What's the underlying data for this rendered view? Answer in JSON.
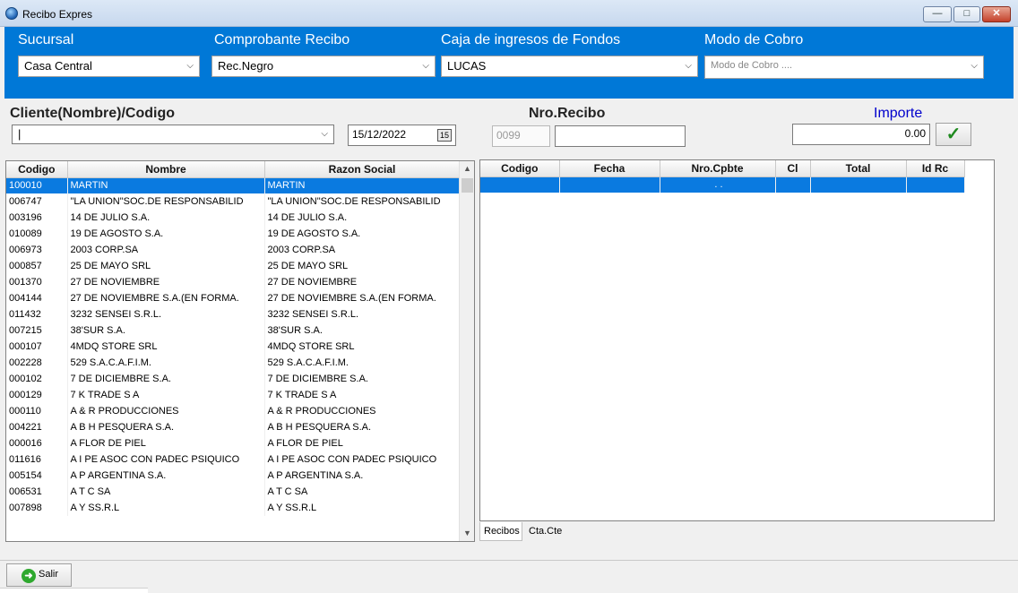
{
  "window": {
    "title": "Recibo Expres",
    "min": "—",
    "max": "□",
    "close": "✕"
  },
  "header": {
    "sucursal_label": "Sucursal",
    "sucursal_value": "Casa Central",
    "comprobante_label": "Comprobante Recibo",
    "comprobante_value": "Rec.Negro",
    "caja_label": "Caja de ingresos de Fondos",
    "caja_value": "LUCAS",
    "modo_label": "Modo de Cobro",
    "modo_placeholder": "Modo de Cobro ...."
  },
  "form": {
    "cliente_label": "Cliente(Nombre)/Codigo",
    "cliente_value": "|",
    "fecha": "15/12/2022",
    "nro_recibo_label": "Nro.Recibo",
    "nro_prefix": "0099",
    "nro_value": "",
    "importe_label": "Importe",
    "importe_value": "0.00"
  },
  "clients": {
    "columns": [
      "Codigo",
      "Nombre",
      "Razon Social"
    ],
    "rows": [
      [
        "100010",
        "MARTIN",
        "MARTIN"
      ],
      [
        "006747",
        "\"LA UNION\"SOC.DE RESPONSABILID",
        "\"LA UNION\"SOC.DE RESPONSABILID"
      ],
      [
        "003196",
        "14 DE JULIO S.A.",
        "14 DE JULIO S.A."
      ],
      [
        "010089",
        "19 DE AGOSTO S.A.",
        "19 DE AGOSTO S.A."
      ],
      [
        "006973",
        "2003 CORP.SA",
        "2003 CORP.SA"
      ],
      [
        "000857",
        "25 DE MAYO SRL",
        "25 DE MAYO SRL"
      ],
      [
        "001370",
        "27 DE NOVIEMBRE",
        "27 DE NOVIEMBRE"
      ],
      [
        "004144",
        "27 DE NOVIEMBRE S.A.(EN FORMA.",
        "27 DE NOVIEMBRE S.A.(EN FORMA."
      ],
      [
        "011432",
        "3232 SENSEI S.R.L.",
        "3232 SENSEI S.R.L."
      ],
      [
        "007215",
        "38'SUR S.A.",
        "38'SUR S.A."
      ],
      [
        "000107",
        "4MDQ STORE SRL",
        "4MDQ STORE SRL"
      ],
      [
        "002228",
        "529  S.A.C.A.F.I.M.",
        "529  S.A.C.A.F.I.M."
      ],
      [
        "000102",
        "7 DE DICIEMBRE S.A.",
        "7 DE DICIEMBRE S.A."
      ],
      [
        "000129",
        "7 K TRADE S A",
        "7 K TRADE S A"
      ],
      [
        "000110",
        "A & R PRODUCCIONES",
        "A & R PRODUCCIONES"
      ],
      [
        "004221",
        "A B H PESQUERA S.A.",
        "A B H PESQUERA S.A."
      ],
      [
        "000016",
        "A FLOR DE PIEL",
        "A FLOR DE PIEL"
      ],
      [
        "011616",
        "A I PE ASOC CON PADEC PSIQUICO",
        "A I PE ASOC CON PADEC PSIQUICO"
      ],
      [
        "005154",
        "A P ARGENTINA S.A.",
        "A P ARGENTINA S.A."
      ],
      [
        "006531",
        "A T C SA",
        "A T C SA"
      ],
      [
        "007898",
        "A Y SS.R.L",
        "A Y SS.R.L"
      ]
    ]
  },
  "receipts": {
    "columns": [
      "Codigo",
      "Fecha",
      "Nro.Cpbte",
      "Cl",
      "Total",
      "Id Rc"
    ],
    "rows": [
      [
        "",
        "",
        " .  . ",
        "",
        "",
        ""
      ]
    ]
  },
  "tabs": [
    "Recibos",
    "Cta.Cte"
  ],
  "footer": {
    "salir_label": "Salir"
  }
}
